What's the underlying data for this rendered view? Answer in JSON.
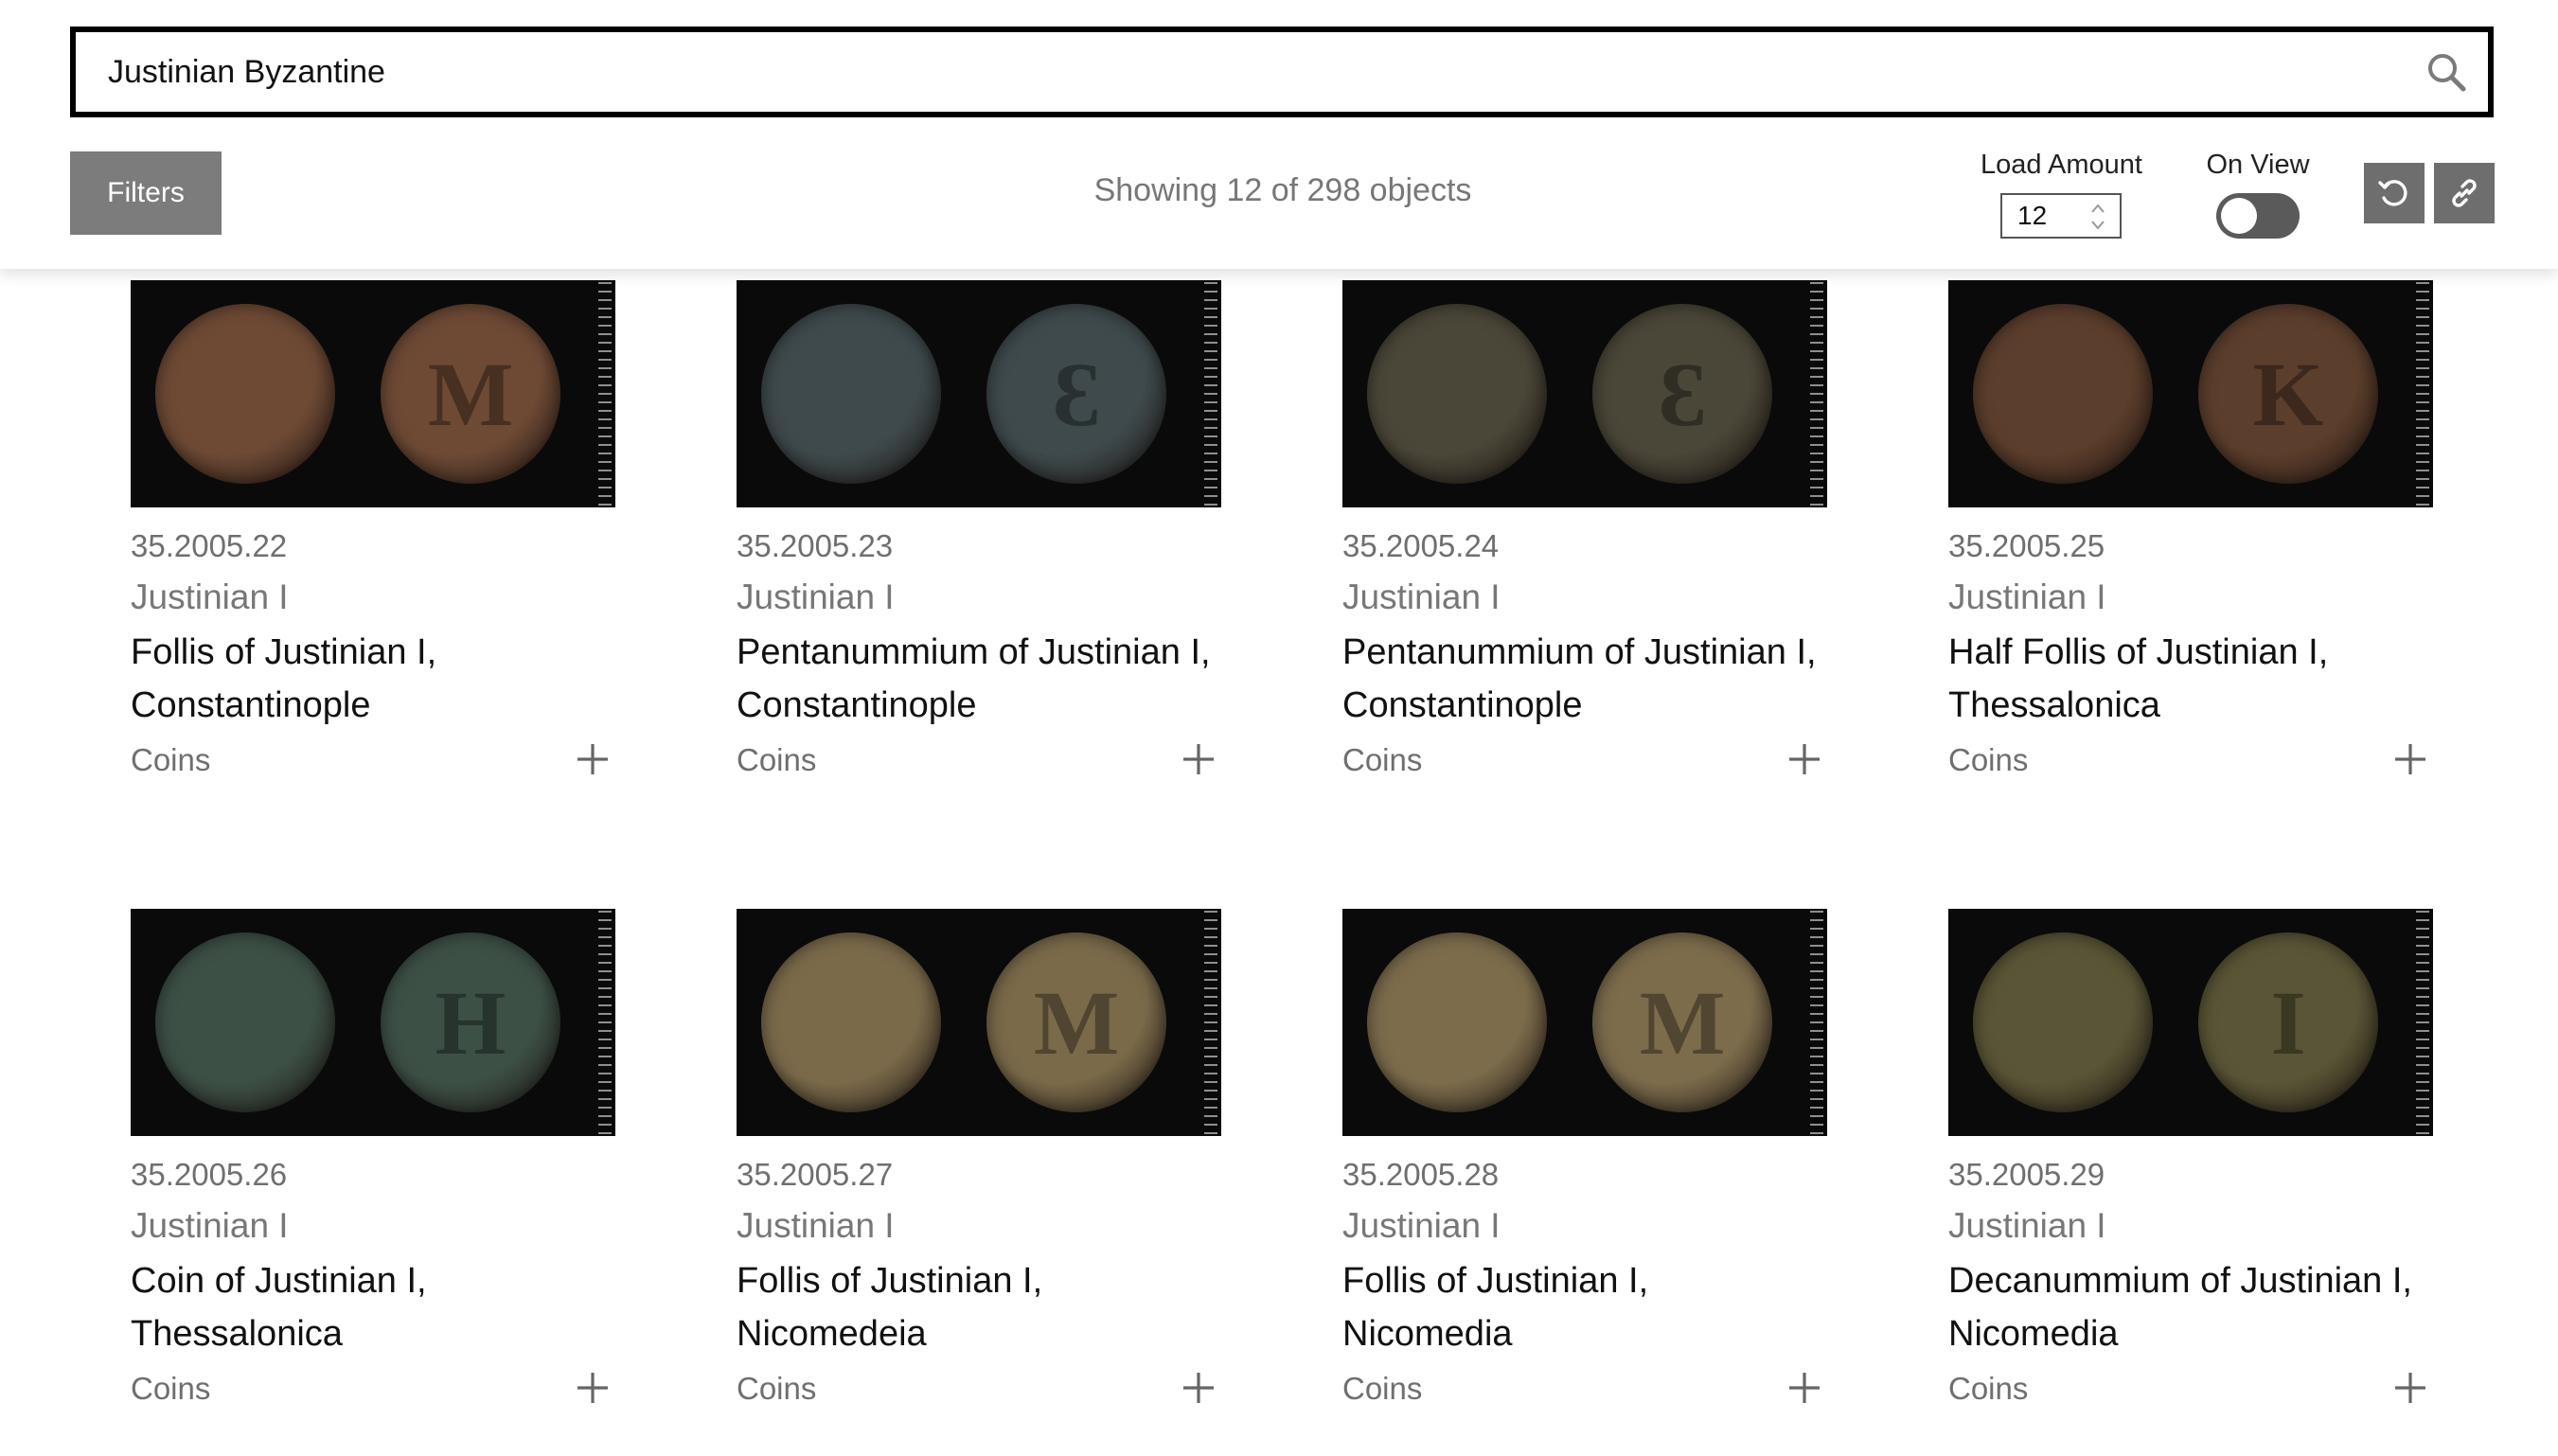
{
  "search": {
    "value": "Justinian Byzantine"
  },
  "toolbar": {
    "filters_label": "Filters",
    "showing_text": "Showing 12 of 298 objects",
    "load_amount_label": "Load Amount",
    "load_amount_value": "12",
    "on_view_label": "On View",
    "on_view_enabled": false
  },
  "icons": {
    "search": "search-icon",
    "stepper": "stepper-arrows-icon",
    "reset": "reset-icon",
    "link": "link-icon",
    "add": "plus-icon"
  },
  "colors": {
    "filters_button": "#7c7c7c",
    "icon_buttons": "#6e6e6e",
    "toggle_off": "#5a5a5a",
    "thumbnail_background": "#0a0a0a"
  },
  "cards": [
    {
      "accession": "35.2005.22",
      "artist": "Justinian I",
      "title": "Follis of Justinian I, Constantinople",
      "classification": "Coins",
      "coin_color": "#6e4a35",
      "obverse_mark": "",
      "reverse_mark": "M"
    },
    {
      "accession": "35.2005.23",
      "artist": "Justinian I",
      "title": "Pentanummium of Justinian I, Constantinople",
      "classification": "Coins",
      "coin_color": "#3f4a4d",
      "obverse_mark": "",
      "reverse_mark": "Ɛ"
    },
    {
      "accession": "35.2005.24",
      "artist": "Justinian I",
      "title": "Pentanummium of Justinian I, Constantinople",
      "classification": "Coins",
      "coin_color": "#4a4638",
      "obverse_mark": "",
      "reverse_mark": "Ɛ"
    },
    {
      "accession": "35.2005.25",
      "artist": "Justinian I",
      "title": "Half Follis of Justinian I, Thessalonica",
      "classification": "Coins",
      "coin_color": "#5c3e2c",
      "obverse_mark": "",
      "reverse_mark": "K"
    },
    {
      "accession": "35.2005.26",
      "artist": "Justinian I",
      "title": "Coin of Justinian I, Thessalonica",
      "classification": "Coins",
      "coin_color": "#3d5046",
      "obverse_mark": "",
      "reverse_mark": "H"
    },
    {
      "accession": "35.2005.27",
      "artist": "Justinian I",
      "title": "Follis of Justinian I, Nicomedeia",
      "classification": "Coins",
      "coin_color": "#7a6a4a",
      "obverse_mark": "",
      "reverse_mark": "M"
    },
    {
      "accession": "35.2005.28",
      "artist": "Justinian I",
      "title": "Follis of Justinian I, Nicomedia",
      "classification": "Coins",
      "coin_color": "#7c6c4c",
      "obverse_mark": "",
      "reverse_mark": "M"
    },
    {
      "accession": "35.2005.29",
      "artist": "Justinian I",
      "title": "Decanummium of Justinian I, Nicomedia",
      "classification": "Coins",
      "coin_color": "#5a5536",
      "obverse_mark": "",
      "reverse_mark": "I"
    }
  ]
}
